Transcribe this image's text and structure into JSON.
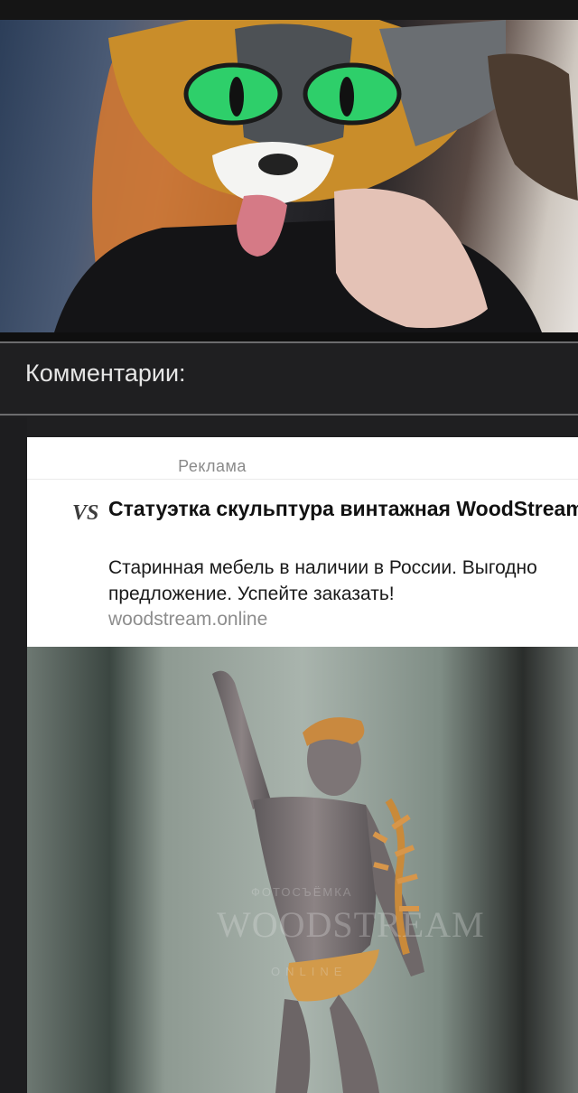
{
  "comments": {
    "header": "Комментарии:"
  },
  "ad": {
    "label": "Реклама",
    "logo_text": "VS",
    "title": "Статуэтка скульптура винтажная WoodStream",
    "description_line1": "Старинная мебель в наличии в России. Выгодно",
    "description_line2": "предложение. Успейте заказать!",
    "domain": "woodstream.online",
    "image_watermark_top": "ФОТОСЪЁМКА",
    "image_watermark": "WOODSTREAM",
    "image_watermark_sub": "ONLINE"
  },
  "colors": {
    "background": "#1f1f21",
    "card": "#ffffff",
    "separator": "#6c6c6e",
    "header_text": "#e6e6e6",
    "muted_text": "#8d8d8d"
  }
}
